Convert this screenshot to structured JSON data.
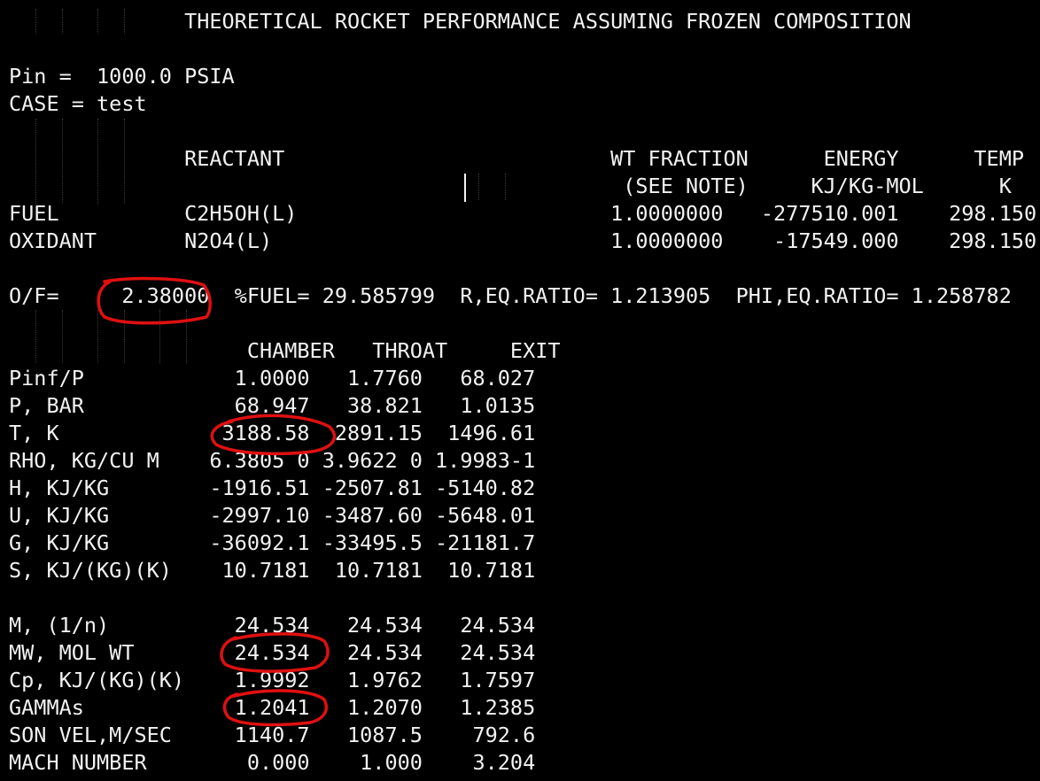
{
  "report": {
    "lines": [
      "              THEORETICAL ROCKET PERFORMANCE ASSUMING FROZEN COMPOSITION",
      "",
      "Pin =  1000.0 PSIA",
      "CASE = test",
      "",
      "              REACTANT                          WT FRACTION      ENERGY      TEMP",
      "                                                 (SEE NOTE)     KJ/KG-MOL      K",
      "FUEL          C2H5OH(L)                         1.0000000   -277510.001    298.150",
      "OXIDANT       N2O4(L)                           1.0000000    -17549.000    298.150",
      "",
      "O/F=     2.38000  %FUEL= 29.585799  R,EQ.RATIO= 1.213905  PHI,EQ.RATIO= 1.258782",
      "",
      "                   CHAMBER   THROAT     EXIT",
      "Pinf/P            1.0000   1.7760   68.027",
      "P, BAR            68.947   38.821   1.0135",
      "T, K             3188.58  2891.15  1496.61",
      "RHO, KG/CU M    6.3805 0 3.9622 0 1.9983-1",
      "H, KJ/KG        -1916.51 -2507.81 -5140.82",
      "U, KJ/KG        -2997.10 -3487.60 -5648.01",
      "G, KJ/KG        -36092.1 -33495.5 -21181.7",
      "S, KJ/(KG)(K)    10.7181  10.7181  10.7181",
      "",
      "M, (1/n)          24.534   24.534   24.534",
      "MW, MOL WT        24.534   24.534   24.534",
      "Cp, KJ/(KG)(K)    1.9992   1.9762   1.7597",
      "GAMMAs            1.2041   1.2070   1.2385",
      "SON VEL,M/SEC     1140.7   1087.5    792.6",
      "MACH NUMBER        0.000    1.000    3.204"
    ]
  },
  "colors": {
    "background": "#000000",
    "text": "#f2f2f2",
    "annotation": "#e01010",
    "indent_guide": "#3a3a3a"
  }
}
